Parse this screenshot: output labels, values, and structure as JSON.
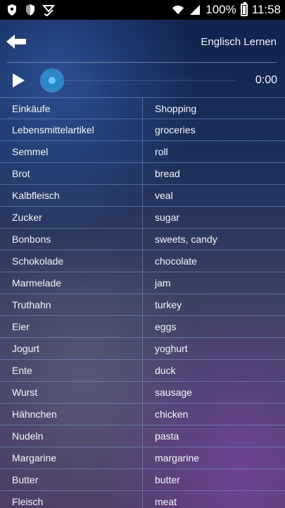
{
  "status_bar": {
    "icons_left": [
      "shield-icon",
      "shield-icon",
      "download-check-icon"
    ],
    "icons_right": [
      "wifi-icon",
      "signal-icon",
      "battery-icon"
    ],
    "battery": "100%",
    "time": "11:58"
  },
  "header": {
    "title": "Englisch Lernen",
    "back_icon": "arrow-left-icon"
  },
  "player": {
    "play_icon": "play-icon",
    "time": "0:00",
    "progress": 0
  },
  "colors": {
    "accent": "#3ba7e8",
    "status_bar_bg": "#000000",
    "divider": "#7896d2"
  },
  "vocabulary": [
    {
      "de": "Einkäufe",
      "en": "Shopping"
    },
    {
      "de": "Lebensmittelartikel",
      "en": "groceries"
    },
    {
      "de": "Semmel",
      "en": "roll"
    },
    {
      "de": "Brot",
      "en": "bread"
    },
    {
      "de": "Kalbfleisch",
      "en": "veal"
    },
    {
      "de": "Zucker",
      "en": "sugar"
    },
    {
      "de": "Bonbons",
      "en": "sweets, candy"
    },
    {
      "de": "Schokolade",
      "en": "chocolate"
    },
    {
      "de": "Marmelade",
      "en": "jam"
    },
    {
      "de": "Truthahn",
      "en": "turkey"
    },
    {
      "de": "Eier",
      "en": "eggs"
    },
    {
      "de": "Jogurt",
      "en": "yoghurt"
    },
    {
      "de": "Ente",
      "en": "duck"
    },
    {
      "de": "Wurst",
      "en": "sausage"
    },
    {
      "de": "Hähnchen",
      "en": "chicken"
    },
    {
      "de": "Nudeln",
      "en": "pasta"
    },
    {
      "de": "Margarine",
      "en": "margarine"
    },
    {
      "de": "Butter",
      "en": "butter"
    },
    {
      "de": "Fleisch",
      "en": "meat"
    }
  ]
}
